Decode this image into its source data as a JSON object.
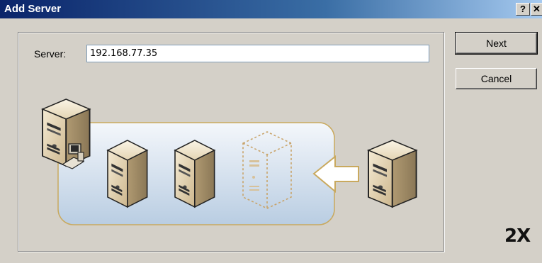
{
  "window": {
    "title": "Add Server",
    "help_label": "?",
    "close_label": "✕"
  },
  "form": {
    "server_label": "Server:",
    "server_value": "192.168.77.35"
  },
  "buttons": {
    "next_label": "Next",
    "cancel_label": "Cancel"
  },
  "brand": {
    "logo_two": "2",
    "logo_x": "X"
  },
  "icons": {
    "help": "help-icon",
    "close": "close-icon",
    "server": "server-tower-icon",
    "placeholder_server": "placeholder-server-icon",
    "arrow": "arrow-left-icon",
    "workstation": "workstation-icon"
  },
  "colors": {
    "title_start": "#0a246a",
    "title_end": "#a6caf0",
    "dialog_bg": "#d4d0c8"
  }
}
